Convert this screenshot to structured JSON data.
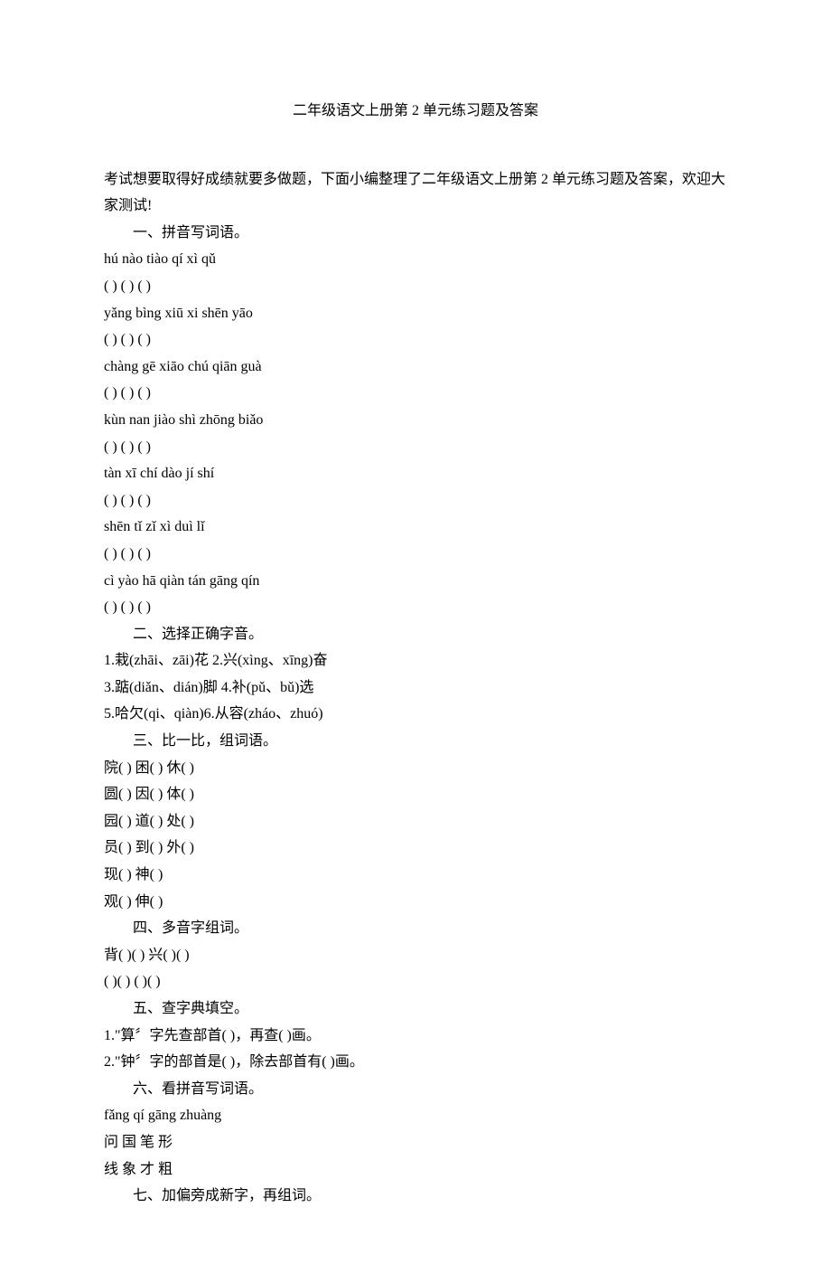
{
  "title": "二年级语文上册第 2 单元练习题及答案",
  "intro": "考试想要取得好成绩就要多做题，下面小编整理了二年级语文上册第 2 单元练习题及答案，欢迎大家测试!",
  "sections": [
    {
      "heading": "一、拼音写词语。",
      "lines": [
        "hú nào tiào qí xì qǔ",
        "( ) ( ) ( )",
        "yǎng bìng xiū xi shēn yāo",
        "( ) ( ) ( )",
        "chàng gē xiāo chú qiān guà",
        "( ) ( ) ( )",
        "kùn nan jiào shì zhōng biǎo",
        "( ) ( ) ( )",
        "tàn xī chí dào jí shí",
        "( ) ( ) ( )",
        "shēn tǐ zǐ xì duì lǐ",
        "( ) ( ) ( )",
        "cì yào hā qiàn tán gāng qín",
        "( ) ( ) ( )"
      ]
    },
    {
      "heading": "二、选择正确字音。",
      "lines": [
        "1.栽(zhāi、zāi)花  2.兴(xìng、xīng)奋",
        "3.踮(diǎn、dián)脚  4.补(pǔ、bǔ)选",
        "5.哈欠(qi、qiàn)6.从容(zháo、zhuó)"
      ]
    },
    {
      "heading": "三、比一比，组词语。",
      "lines": [
        "院( )  困( )  休( )",
        "圆( )  因( )  体( )",
        "园( )  道( )  处( )",
        "员( )  到( )  外( )",
        "现( )  神( )",
        "观( )  伸( )"
      ]
    },
    {
      "heading": "四、多音字组词。",
      "lines": [
        "背( )( )  兴( )( )",
        "( )( ) ( )( )"
      ]
    },
    {
      "heading": "五、查字典填空。",
      "lines": [
        "1.\"算〞字先查部首( )，再查( )画。",
        "2.\"钟〞字的部首是( )，除去部首有( )画。"
      ]
    },
    {
      "heading": "六、看拼音写词语。",
      "lines": [
        "fǎng qí gāng zhuàng",
        "问  国  笔  形",
        "线  象  才  粗"
      ]
    },
    {
      "heading": "七、加偏旁成新字，再组词。",
      "lines": []
    }
  ]
}
